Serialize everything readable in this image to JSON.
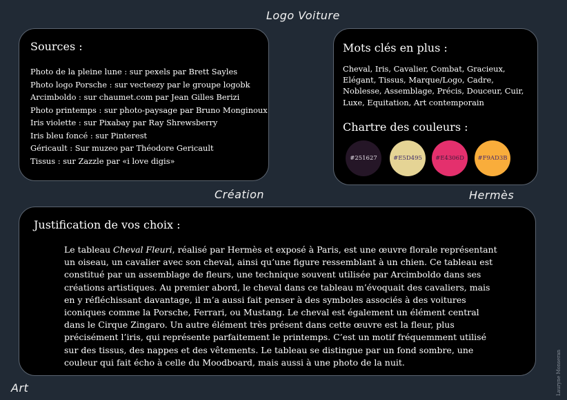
{
  "labels": {
    "top": "Logo Voiture",
    "middle_left": "Création",
    "middle_right": "Hermès",
    "bottom_left": "Art"
  },
  "sources": {
    "title": "Sources :",
    "items": [
      "Photo de la pleine lune : sur  pexels par Brett Sayles",
      "Photo logo Porsche : sur vecteezy par le groupe logobk",
      "Arcimboldo : sur chaumet.com par Jean Gilles Berizi",
      "Photo printemps : sur photo-paysage par Bruno Monginoux",
      "Iris violette : sur Pixabay par Ray Shrewsberry",
      "Iris bleu foncé : sur Pinterest",
      "Géricault : Sur muzeo par Théodore Gericault",
      "Tissus : sur Zazzle par «i love digis»"
    ]
  },
  "keywords": {
    "title": "Mots clés en plus :",
    "text": "Cheval, Iris, Cavalier, Combat, Gracieux, Elégant, Tissus, Marque/Logo, Cadre, Noblesse, Assemblage, Précis, Douceur, Cuir, Luxe, Equitation, Art contemporain"
  },
  "colors": {
    "title": "Chartre des couleurs :",
    "swatches": [
      {
        "label": "#251627",
        "color": "#251627",
        "text_color": "#e6e0e8"
      },
      {
        "label": "#E5D495",
        "color": "#E5D495",
        "text_color": "#3d2a6b"
      },
      {
        "label": "#E4306D",
        "color": "#E4306D",
        "text_color": "#3d1a3a"
      },
      {
        "label": "#F9AD3B",
        "color": "#F9AD3B",
        "text_color": "#4a2a6b"
      }
    ]
  },
  "justification": {
    "title": "Justification de vos choix :",
    "text_before": "Le tableau ",
    "text_italic": "Cheval Fleuri",
    "text_after": ", réalisé par Hermès et exposé à Paris, est une œuvre florale représentant un oiseau, un cavalier avec son cheval, ainsi qu’une figure ressemblant à un chien. Ce tableau est constitué par un assemblage de fleurs, une technique souvent utilisée par Arcimboldo dans ses créations artistiques. Au premier abord, le cheval dans ce tableau m’évoquait des cavaliers, mais en y réfléchissant davantage, il m’a aussi fait penser à des symboles associés à des voitures iconiques comme la Porsche, Ferrari, ou Mustang. Le cheval est également un élément central dans le Cirque Zingaro. Un autre élément très présent dans cette œuvre est la fleur, plus précisément l’iris, qui représente parfaitement le printemps. C’est un motif fréquemment utilisé sur des tissus, des nappes et des vêtements. Le tableau se distingue par un fond sombre, une couleur qui fait écho à celle du Moodboard, mais aussi à une photo de la nuit."
  },
  "signature": "Lauryne Monseran"
}
